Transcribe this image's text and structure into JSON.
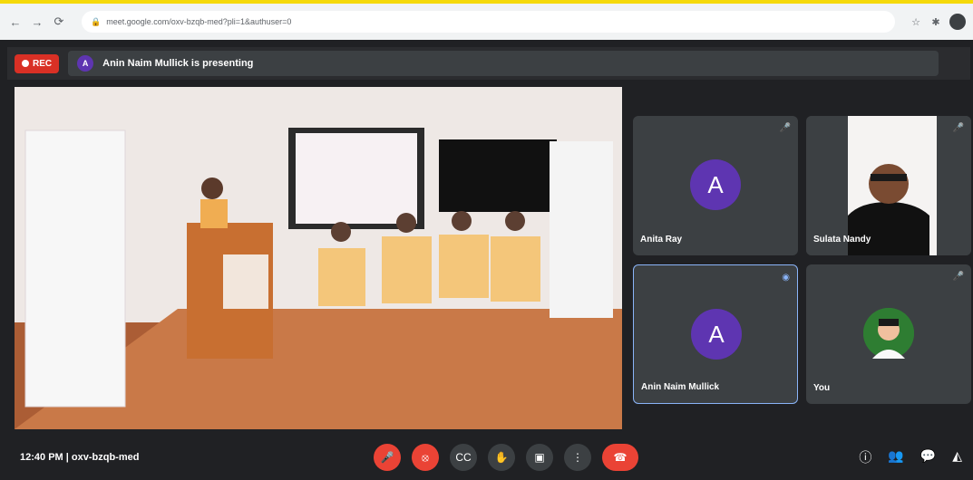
{
  "browser": {
    "url": "meet.google.com/oxv-bzqb-med?pli=1&authuser=0",
    "icons": [
      "back-icon",
      "forward-icon",
      "reload-icon",
      "lock-icon",
      "bookmark-icon",
      "extension-icon",
      "profile-avatar"
    ]
  },
  "meet": {
    "recording_label": "REC",
    "presenter_initial": "A",
    "presenting_text": "Anin Naim Mullick is presenting",
    "participants": [
      {
        "name": "Anita Ray",
        "initial": "A",
        "avatar_color": "#5e35b1",
        "muted": true
      },
      {
        "name": "Sulata Nandy",
        "initial": "",
        "avatar_color": "#ffffff",
        "muted": true
      },
      {
        "name": "Anin Naim Mullick",
        "initial": "A",
        "avatar_color": "#5e35b1",
        "muted": false
      },
      {
        "name": "You",
        "initial": "",
        "avatar_color": "#2e7d32",
        "muted": true
      }
    ],
    "time": "12:40 PM",
    "meeting_code": "oxv-bzqb-med"
  },
  "colors": {
    "background": "#202124",
    "tile": "#3c4043",
    "accent_red": "#ea4335",
    "rec_red": "#d93025"
  }
}
